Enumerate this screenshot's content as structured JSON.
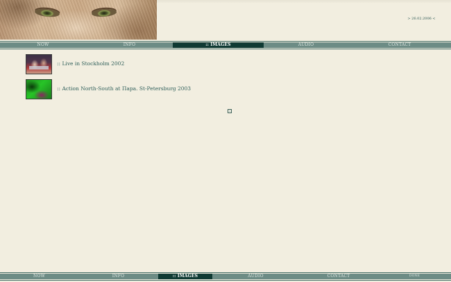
{
  "header": {
    "banner_alt": "lynx eyes banner",
    "date_text": "> 26.02.2006 <"
  },
  "nav_top": {
    "items": [
      {
        "label": "NOW",
        "active": false
      },
      {
        "label": "INFO",
        "active": false
      },
      {
        "label": ":: IMAGES",
        "active": true
      },
      {
        "label": "AUDIO",
        "active": false
      },
      {
        "label": "CONTACT",
        "active": false
      }
    ]
  },
  "gallery": {
    "items": [
      {
        "caption": ":: Live in Stockholm 2002"
      },
      {
        "caption": ":: Action North-South at Пара. St-Petersburg 2003"
      }
    ]
  },
  "nav_bottom": {
    "items": [
      {
        "label": "NOW",
        "active": false
      },
      {
        "label": "INFO",
        "active": false
      },
      {
        "label": ":: IMAGES",
        "active": true
      },
      {
        "label": "AUDIO",
        "active": false
      },
      {
        "label": "CONTACT",
        "active": false
      },
      {
        "label": "DONE",
        "active": false
      }
    ]
  },
  "colors": {
    "background": "#f2eee0",
    "nav_strip": "#6d8c85",
    "nav_active": "#0f3a33",
    "link_text": "#2f5f5a"
  }
}
